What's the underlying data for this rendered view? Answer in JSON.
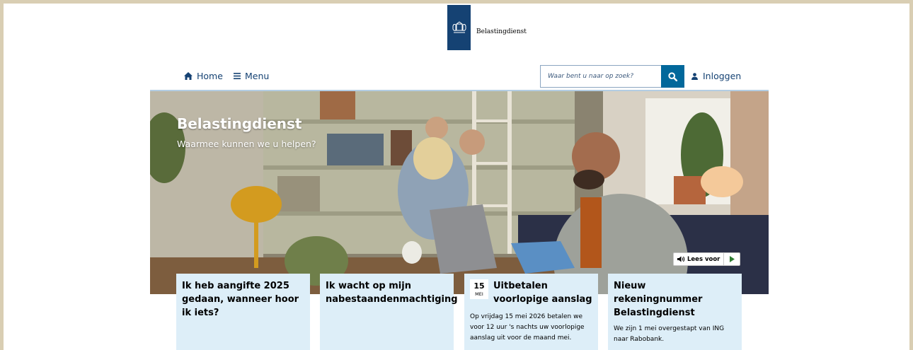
{
  "brand": {
    "name": "Belastingdienst",
    "color": "#154273"
  },
  "nav": {
    "home_label": "Home",
    "menu_label": "Menu",
    "search_placeholder": "Waar bent u naar op zoek?",
    "login_label": "Inloggen"
  },
  "hero": {
    "title": "Belastingdienst",
    "subtitle": "Waarmee kunnen we u helpen?",
    "read_aloud_label": "Lees voor"
  },
  "cards": [
    {
      "title": "Ik heb aangifte 2025 gedaan, wanneer hoor ik iets?"
    },
    {
      "title": "Ik wacht op mijn nabestaandenmachtiging"
    },
    {
      "date_day": "15",
      "date_month": "MEI",
      "title": "Uitbetalen voorlopige aanslag",
      "text": "Op vrijdag 15 mei 2026 betalen we voor 12 uur 's nachts uw voorlopige aanslag uit voor de maand mei."
    },
    {
      "title": "Nieuw rekeningnummer Belastingdienst",
      "text": "We zijn 1 mei overgestapt van ING naar Rabobank."
    }
  ],
  "colors": {
    "search_button": "#01689b",
    "card_background": "#ddeef8",
    "frame": "#d9ceb3"
  }
}
